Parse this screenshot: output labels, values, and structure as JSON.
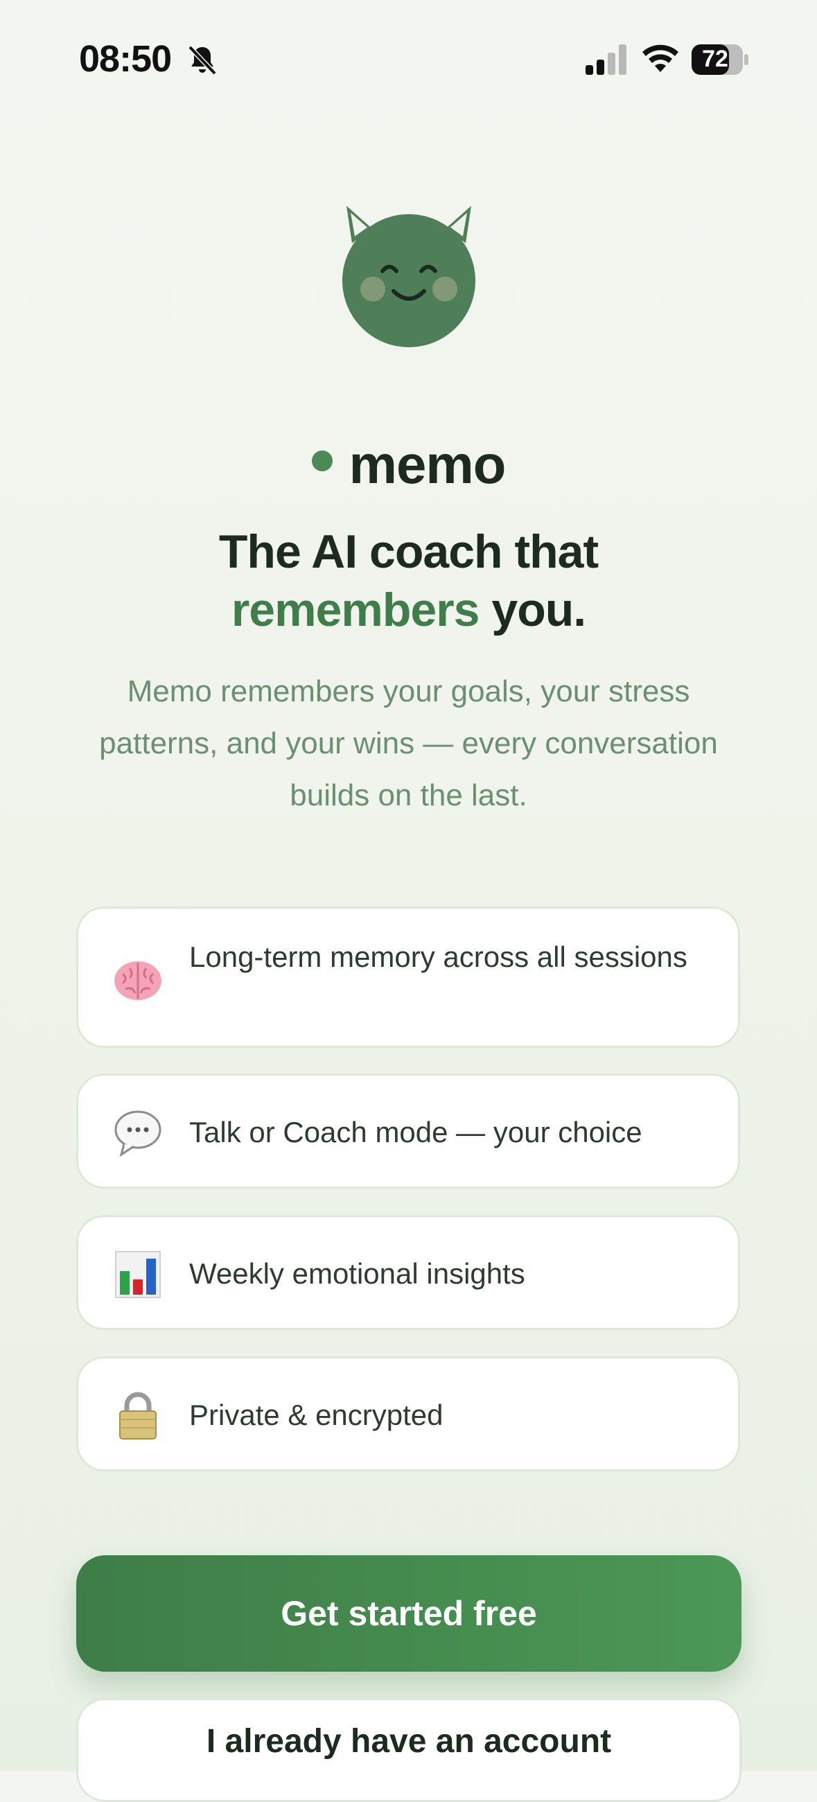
{
  "status_bar": {
    "time": "08:50",
    "battery": "72",
    "icons": [
      "bell-off-icon",
      "signal-icon",
      "wifi-icon",
      "battery-icon"
    ]
  },
  "brand": {
    "name": "memo",
    "accent_color": "#4a8a57"
  },
  "headline": {
    "line1": "The AI coach that",
    "accent": "remembers",
    "rest": " you."
  },
  "subtitle": "Memo remembers your goals, your stress patterns, and your wins — every conversation builds on the last.",
  "features": [
    {
      "icon": "brain-icon",
      "label": "Long-term memory across all sessions"
    },
    {
      "icon": "speech-bubble-icon",
      "label": "Talk or Coach mode — your choice"
    },
    {
      "icon": "bar-chart-icon",
      "label": "Weekly emotional insights"
    },
    {
      "icon": "lock-icon",
      "label": "Private & encrypted"
    }
  ],
  "actions": {
    "primary": "Get started free",
    "secondary": "I already have an account"
  },
  "colors": {
    "primary": "#3e7d47",
    "background": "#f3f6f0",
    "text": "#1d2a20",
    "muted": "#6b8f72"
  }
}
